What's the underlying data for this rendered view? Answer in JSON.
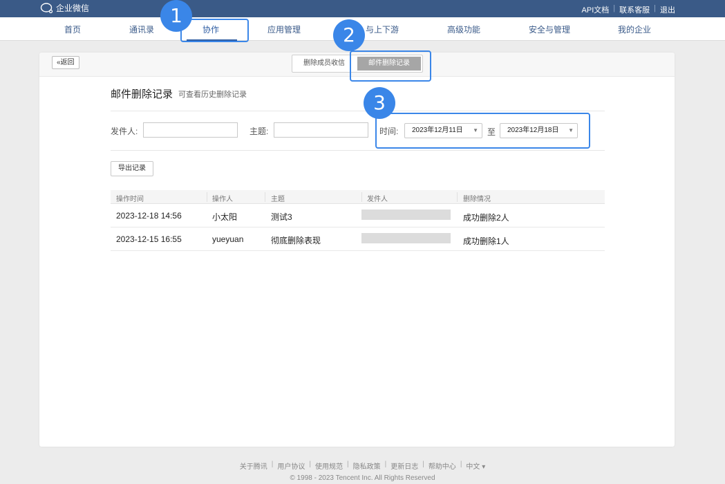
{
  "app": {
    "brand": "企业微信"
  },
  "topbar": {
    "links": [
      "API文档",
      "联系客服",
      "退出"
    ]
  },
  "nav": {
    "items": [
      "首页",
      "通讯录",
      "协作",
      "应用管理",
      "与上下游",
      "高级功能",
      "安全与管理",
      "我的企业"
    ],
    "active_index": 2
  },
  "card": {
    "back_label": "«返回",
    "tabs": [
      "删除成员收信",
      "邮件删除记录"
    ],
    "active_tab": 1
  },
  "page": {
    "title": "邮件删除记录",
    "subtitle": "可查看历史删除记录"
  },
  "filters": {
    "sender_label": "发件人:",
    "sender_value": "",
    "subject_label": "主题:",
    "subject_value": "",
    "time_label": "时间:",
    "start_date": "2023年12月11日",
    "to_label": "至",
    "end_date": "2023年12月18日"
  },
  "export_label": "导出记录",
  "table": {
    "headers": [
      "操作时间",
      "操作人",
      "主题",
      "发件人",
      "删除情况"
    ],
    "rows": [
      {
        "time": "2023-12-18 14:56",
        "operator": "小太阳",
        "subject": "测试3",
        "sender": "",
        "result": "成功删除2人"
      },
      {
        "time": "2023-12-15 16:55",
        "operator": "yueyuan",
        "subject": "彻底删除表现",
        "sender": "",
        "result": "成功删除1人"
      }
    ]
  },
  "callouts": [
    "1",
    "2",
    "3"
  ],
  "footer": {
    "links": [
      "关于腾讯",
      "用户协议",
      "使用规范",
      "隐私政策",
      "更新日志",
      "帮助中心",
      "中文 ▾"
    ],
    "copyright": "© 1998 - 2023 Tencent Inc. All Rights Reserved"
  },
  "colors": {
    "topbar": "#3a5a87",
    "accent": "#2f5ea3",
    "callout": "#3a86e8"
  }
}
